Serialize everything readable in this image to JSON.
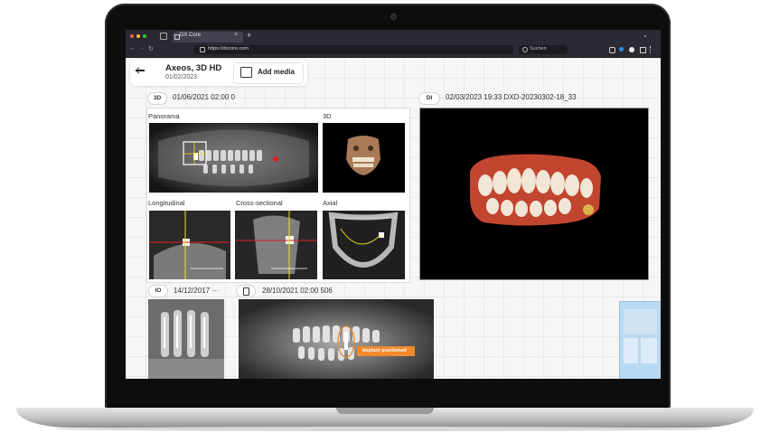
{
  "browser": {
    "tab_title": "DX Core",
    "tab_close": "×",
    "new_tab": "+",
    "window_menu": "⌄",
    "url": "https://dxcore.com",
    "search_placeholder": "Suchen",
    "nav": {
      "back": "←",
      "forward": "→",
      "reload": "↻"
    }
  },
  "header": {
    "back_icon": "arrow-left-icon",
    "title": "Axeos, 3D HD",
    "date": "01/02/2023",
    "add_media_label": "Add media"
  },
  "groups": [
    {
      "badge": "3D",
      "timestamp": "01/06/2021 02:00 0"
    },
    {
      "badge": "DI",
      "timestamp": "02/03/2023 19:33 DXD-20230302-18_33"
    },
    {
      "badge": "IO",
      "timestamp": "14/12/2017 ···"
    },
    {
      "badge": "document-icon",
      "timestamp": "28/10/2021 02:00 506"
    }
  ],
  "panels": {
    "panorama": "Panorama",
    "threed": "3D",
    "longitudinal": "Longitudinal",
    "cross_sectional": "Cross-sectional",
    "axial": "Axial"
  },
  "annotation": "Implant positioned",
  "colors": {
    "accent_orange": "#f08a2c",
    "crosshair_red": "#e02020",
    "crosshair_yellow": "#f0e020",
    "selection_blue": "#a9d4f2"
  }
}
